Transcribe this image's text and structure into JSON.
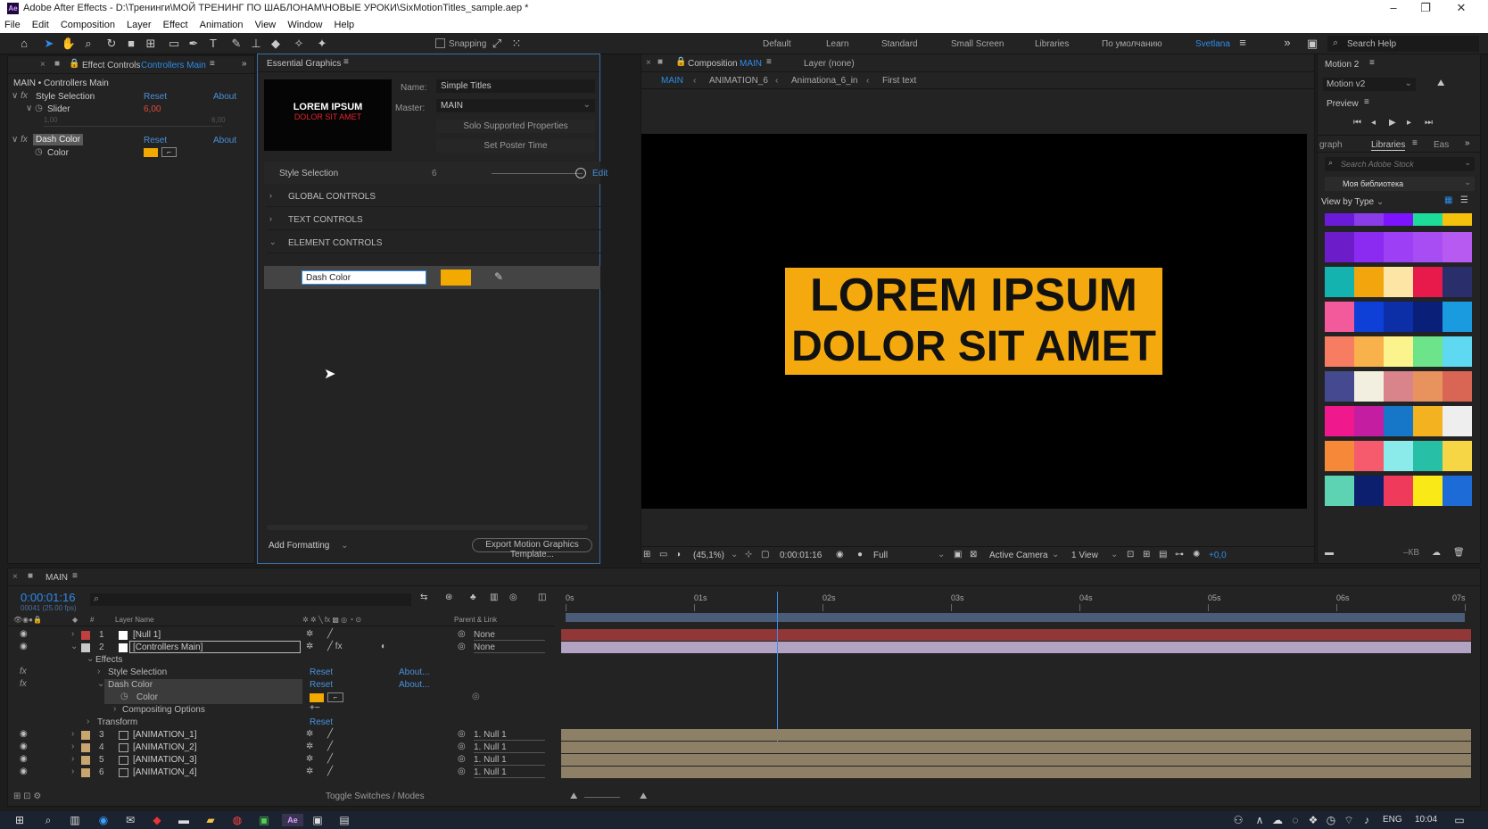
{
  "window": {
    "title": "Adobe After Effects - D:\\Тренинги\\МОЙ ТРЕНИНГ ПО ШАБЛОНАМ\\НОВЫЕ УРОКИ\\SixMotionTitles_sample.aep *",
    "logo": "Ae"
  },
  "menu": [
    "File",
    "Edit",
    "Composition",
    "Layer",
    "Effect",
    "Animation",
    "View",
    "Window",
    "Help"
  ],
  "toolbar": {
    "snapping_label": "Snapping",
    "workspaces": [
      "Default",
      "Learn",
      "Standard",
      "Small Screen",
      "Libraries",
      "По умолчанию"
    ],
    "active_workspace": "Svetlana",
    "search_help": "Search Help"
  },
  "effect_controls": {
    "tab_label": "Effect Controls",
    "tab_layer": "Controllers Main",
    "header": "MAIN • Controllers Main",
    "effects": [
      {
        "name": "Style Selection",
        "reset": "Reset",
        "about": "About",
        "prop": "Slider",
        "value": "6,00",
        "min": "1,00",
        "max": "6,00"
      },
      {
        "name": "Dash Color",
        "reset": "Reset",
        "about": "About",
        "prop": "Color"
      }
    ],
    "color_value": "#f2a900"
  },
  "essential_graphics": {
    "tab_label": "Essential Graphics",
    "poster_line1": "LOREM IPSUM",
    "poster_line2": "DOLOR SIT AMET",
    "name_label": "Name:",
    "name_value": "Simple Titles",
    "master_label": "Master:",
    "master_value": "MAIN",
    "solo_button": "Solo Supported Properties",
    "poster_button": "Set Poster Time",
    "style_label": "Style Selection",
    "style_value": "6",
    "edit_label": "Edit",
    "sections": [
      "GLOBAL CONTROLS",
      "TEXT CONTROLS",
      "ELEMENT CONTROLS"
    ],
    "dash_color_field": "Dash Color",
    "add_formatting": "Add Formatting",
    "export_button": "Export Motion Graphics Template..."
  },
  "composition": {
    "tab_label": "Composition",
    "tab_comp": "MAIN",
    "layer_tab": "Layer (none)",
    "breadcrumbs": [
      "MAIN",
      "ANIMATION_6",
      "Animationa_6_in",
      "First text"
    ],
    "title_line1": "LOREM IPSUM",
    "title_line2": "DOLOR SIT AMET",
    "title_bg": "#f4aa0e",
    "footer": {
      "zoom": "(45,1%)",
      "time": "0:00:01:16",
      "resolution": "Full",
      "camera": "Active Camera",
      "views": "1 View",
      "exposure": "+0,0"
    }
  },
  "right_panel": {
    "motion_tab": "Motion 2",
    "motion_select": "Motion v2",
    "preview_tab": "Preview",
    "tabs": [
      "graph",
      "Libraries",
      "Eas"
    ],
    "search_placeholder": "Search Adobe Stock",
    "library_name": "Моя библиотека",
    "view_by": "View by Type",
    "palettes": [
      [
        "#6a1bd8",
        "#8a3de6",
        "#7c14ff",
        "#1ddc9a",
        "#f4c20d"
      ],
      [
        "#6d1cc9",
        "#8b2bf2",
        "#9d3ff5",
        "#a84cf4",
        "#b65af2"
      ],
      [
        "#14b3b0",
        "#f2a50c",
        "#fde5a6",
        "#e8194b",
        "#2a2f6b"
      ],
      [
        "#f25a9c",
        "#0e3fd6",
        "#0c2fa8",
        "#0a1f78",
        "#1a9be0"
      ],
      [
        "#f67c62",
        "#f9b14c",
        "#fbf38b",
        "#6de38a",
        "#5fd8f2"
      ],
      [
        "#45498f",
        "#f3efe0",
        "#d9848a",
        "#e8925e",
        "#d96655"
      ],
      [
        "#f0188d",
        "#c51da2",
        "#1677c9",
        "#f3b21f",
        "#eeeeee"
      ],
      [
        "#f6883a",
        "#f65a6d",
        "#8beaea",
        "#27c0a7",
        "#f7d646"
      ],
      [
        "#5ed3b4",
        "#0c1f6e",
        "#f03a5c",
        "#f9ea17",
        "#1d6bd6"
      ]
    ]
  },
  "timeline": {
    "tab_label": "MAIN",
    "timecode": "0:00:01:16",
    "fps": "00041 (25.00 fps)",
    "col_layer_name": "Layer Name",
    "col_parent": "Parent & Link",
    "ticks": [
      "0s",
      "01s",
      "02s",
      "03s",
      "04s",
      "05s",
      "06s",
      "07s"
    ],
    "layers": [
      {
        "num": "1",
        "name": "[Null 1]",
        "parent": "None",
        "color": "#c04040"
      },
      {
        "num": "2",
        "name": "[Controllers Main]",
        "parent": "None",
        "color": "#c8c8c8"
      }
    ],
    "props": {
      "effects": "Effects",
      "style_selection": "Style Selection",
      "dash_color": "Dash Color",
      "color": "Color",
      "compositing": "Compositing Options",
      "transform": "Transform",
      "reset": "Reset",
      "about": "About..."
    },
    "anim_layers": [
      {
        "num": "3",
        "name": "[ANIMATION_1]",
        "parent": "1. Null 1"
      },
      {
        "num": "4",
        "name": "[ANIMATION_2]",
        "parent": "1. Null 1"
      },
      {
        "num": "5",
        "name": "[ANIMATION_3]",
        "parent": "1. Null 1"
      },
      {
        "num": "6",
        "name": "[ANIMATION_4]",
        "parent": "1. Null 1"
      }
    ],
    "toggle_label": "Toggle Switches / Modes",
    "playhead_fraction": 0.235
  },
  "taskbar": {
    "lang": "ENG",
    "time": "10:04"
  }
}
